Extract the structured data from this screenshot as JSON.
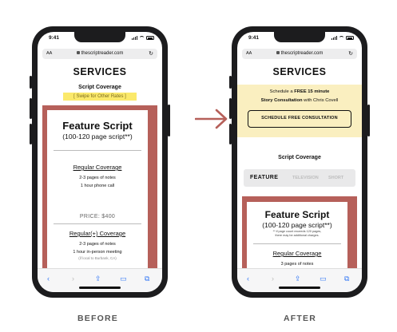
{
  "status_time": "9:41",
  "url": "thescriptreader.com",
  "aa_label": "AA",
  "services_title": "SERVICES",
  "before": {
    "script_coverage": "Script Coverage",
    "swipe_note": "[ Swipe for Other Rates ]",
    "card": {
      "title": "Feature Script",
      "pages": "(100-120 page script**)",
      "regular_coverage": "Regular Coverage",
      "rc_line1": "2-3 pages of notes",
      "rc_line2": "1 hour phone call",
      "price": "PRICE: $400",
      "regular_plus": "Regular(+) Coverage",
      "rp_line1": "2-3 pages of notes",
      "rp_line2": "1 hour in-person meeting",
      "rp_line3": "(if local to Burbank, CA)"
    }
  },
  "after": {
    "banner_line1_prefix": "Schedule a ",
    "banner_line1_bold": "FREE 15 minute",
    "banner_line2_bold": "Story Consultation",
    "banner_line2_suffix": " with Chris Covell",
    "cta_label": "SCHEDULE FREE CONSULTATION",
    "script_coverage": "Script Coverage",
    "tabs": [
      "FEATURE",
      "TELEVISION",
      "SHORT"
    ],
    "card": {
      "title": "Feature Script",
      "pages": "(100-120 page script**)",
      "footnote1": "** if page count exceeds 120 pages,",
      "footnote2": "there may be additional charges.",
      "regular_coverage": "Regular Coverage",
      "rc_line1": "3 pages of notes"
    }
  },
  "captions": {
    "before": "BEFORE",
    "after": "AFTER"
  },
  "colors": {
    "accent_red": "#b6605a",
    "highlight_yellow": "#fbe96b",
    "banner_cream": "#faefc0",
    "safari_blue": "#3478f6"
  }
}
